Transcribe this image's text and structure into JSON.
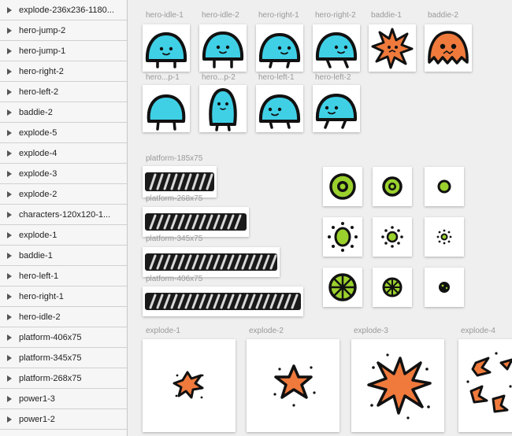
{
  "sidebar": {
    "items": [
      {
        "label": "explode-236x236-1180..."
      },
      {
        "label": "hero-jump-2"
      },
      {
        "label": "hero-jump-1"
      },
      {
        "label": "hero-right-2"
      },
      {
        "label": "hero-left-2"
      },
      {
        "label": "baddie-2"
      },
      {
        "label": "explode-5"
      },
      {
        "label": "explode-4"
      },
      {
        "label": "explode-3"
      },
      {
        "label": "explode-2"
      },
      {
        "label": "characters-120x120-1..."
      },
      {
        "label": "explode-1"
      },
      {
        "label": "baddie-1"
      },
      {
        "label": "hero-left-1"
      },
      {
        "label": "hero-right-1"
      },
      {
        "label": "hero-idle-2"
      },
      {
        "label": "platform-406x75"
      },
      {
        "label": "platform-345x75"
      },
      {
        "label": "platform-268x75"
      },
      {
        "label": "power1-3"
      },
      {
        "label": "power1-2"
      }
    ]
  },
  "characters": {
    "row1": [
      {
        "label": "hero-idle-1",
        "icon": "hero-idle-icon"
      },
      {
        "label": "hero-idle-2",
        "icon": "hero-idle-icon"
      },
      {
        "label": "hero-right-1",
        "icon": "hero-right-icon"
      },
      {
        "label": "hero-right-2",
        "icon": "hero-right-icon"
      },
      {
        "label": "baddie-1",
        "icon": "baddie-star-icon"
      },
      {
        "label": "baddie-2",
        "icon": "baddie-ghost-icon"
      }
    ],
    "row2": [
      {
        "label": "hero...p-1",
        "icon": "hero-jump-icon"
      },
      {
        "label": "hero...p-2",
        "icon": "hero-jump-icon"
      },
      {
        "label": "hero-left-1",
        "icon": "hero-left-icon"
      },
      {
        "label": "hero-left-2",
        "icon": "hero-left-icon"
      }
    ]
  },
  "platforms": [
    {
      "label": "platform-185x75"
    },
    {
      "label": "platform-268x75"
    },
    {
      "label": "platform-345x75"
    },
    {
      "label": "platform-406x75"
    }
  ],
  "powerups": [
    [
      "power-ring-icon",
      "power-ring-icon",
      "power-dot-icon"
    ],
    [
      "power-burst-icon",
      "power-burst-icon",
      "power-burst-icon"
    ],
    [
      "power-wheel-icon",
      "power-wheel-icon",
      "power-dark-icon"
    ]
  ],
  "explosions": [
    {
      "label": "explode-1"
    },
    {
      "label": "explode-2"
    },
    {
      "label": "explode-3"
    },
    {
      "label": "explode-4"
    }
  ],
  "colors": {
    "hero": "#3fd0e6",
    "baddie": "#f07a3c",
    "power": "#9bd12d",
    "outline": "#111111"
  }
}
